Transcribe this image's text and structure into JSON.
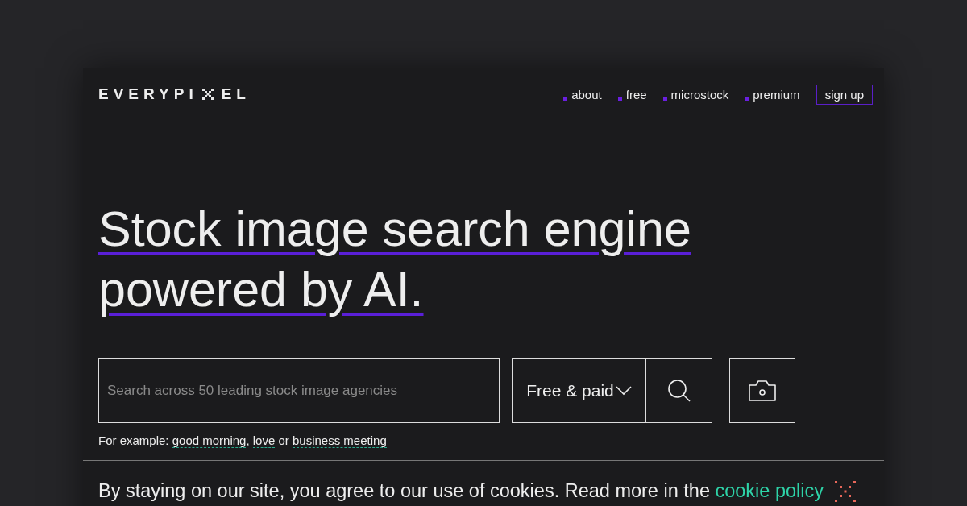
{
  "logo": {
    "left": "EVERYPI",
    "right": "EL"
  },
  "nav": [
    {
      "label": "about"
    },
    {
      "label": "free"
    },
    {
      "label": "microstock"
    },
    {
      "label": "premium"
    }
  ],
  "sign_up": "sign up",
  "headline": [
    "Stock image search engine",
    "powered by AI."
  ],
  "search": {
    "placeholder": "Search across 50 leading stock image agencies",
    "filter": "Free & paid"
  },
  "examples": [
    {
      "kind": "text",
      "text": "For example: "
    },
    {
      "kind": "link",
      "text": "good morning"
    },
    {
      "kind": "text",
      "text": ", "
    },
    {
      "kind": "link",
      "text": "love"
    },
    {
      "kind": "text",
      "text": " or "
    },
    {
      "kind": "link",
      "text": "business meeting"
    }
  ],
  "cookie": {
    "text": "By staying on our site, you agree to our use of cookies. Read more in the ",
    "link": "cookie policy"
  }
}
